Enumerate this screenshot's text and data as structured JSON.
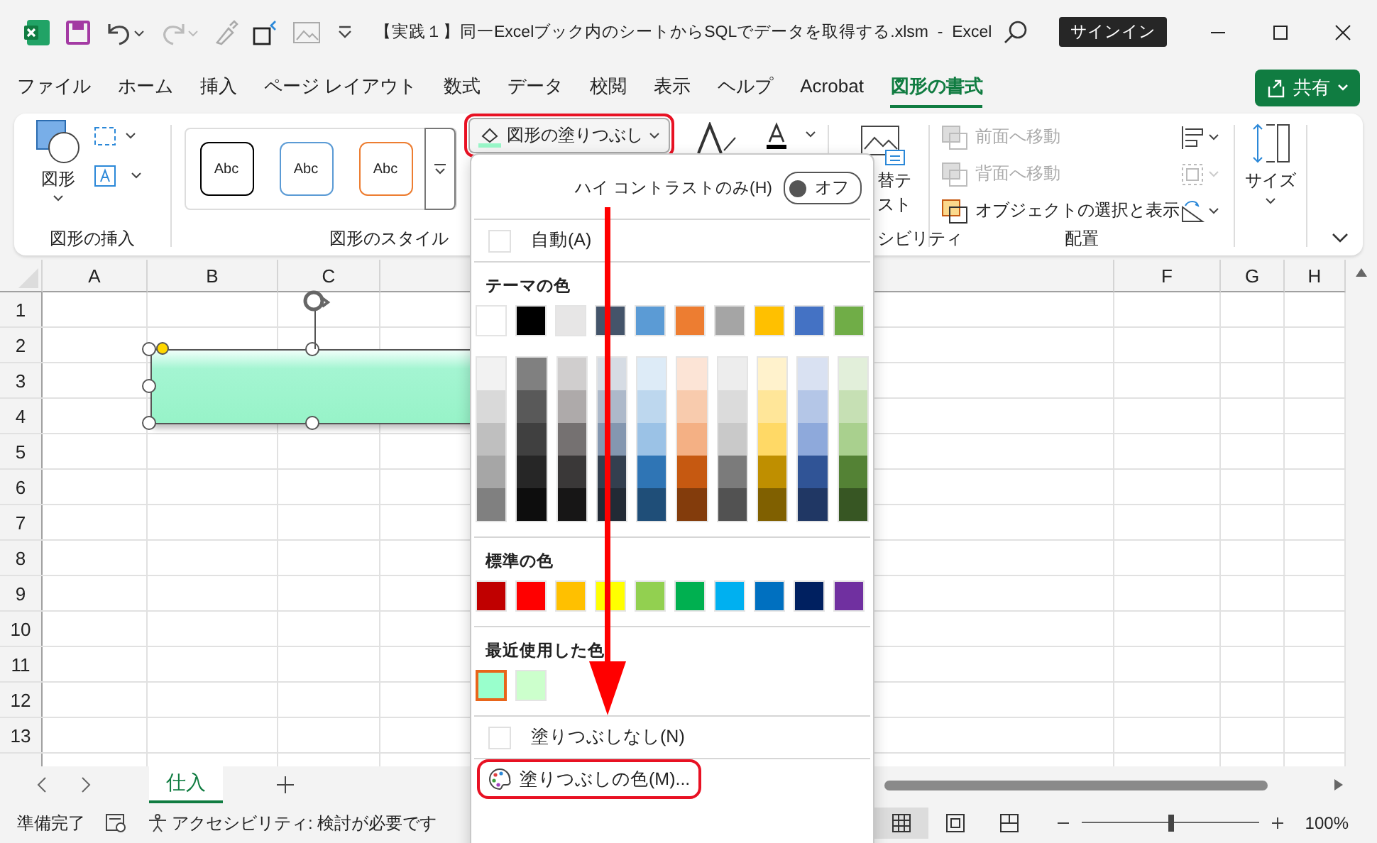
{
  "title_bar": {
    "title": "【実践１】同一Excelブック内のシートからSQLでデータを取得する.xlsm  -  Excel",
    "sign_in": "サインイン"
  },
  "menu_tabs": [
    {
      "label": "ファイル",
      "selected": false
    },
    {
      "label": "ホーム",
      "selected": false
    },
    {
      "label": "挿入",
      "selected": false
    },
    {
      "label": "ページ レイアウト",
      "selected": false
    },
    {
      "label": "数式",
      "selected": false
    },
    {
      "label": "データ",
      "selected": false
    },
    {
      "label": "校閲",
      "selected": false
    },
    {
      "label": "表示",
      "selected": false
    },
    {
      "label": "ヘルプ",
      "selected": false
    },
    {
      "label": "Acrobat",
      "selected": false
    },
    {
      "label": "図形の書式",
      "selected": true
    }
  ],
  "share_button": {
    "label": "共有"
  },
  "ribbon": {
    "insert_group": {
      "shapes": "図形",
      "label": "図形の挿入"
    },
    "style_group": {
      "samples": [
        {
          "label": "Abc",
          "color": "#000000"
        },
        {
          "label": "Abc",
          "color": "#5b9bd5"
        },
        {
          "label": "Abc",
          "color": "#ed7d31"
        }
      ],
      "label": "図形のスタイル"
    },
    "fill_button": {
      "label": "図形の塗りつぶし",
      "highlighted": true
    },
    "alt_text": {
      "lines": [
        "替テ",
        "スト"
      ],
      "label": "シビリティ"
    },
    "arrange": {
      "items": [
        {
          "label": "前面へ移動",
          "disabled": true
        },
        {
          "label": "背面へ移動",
          "disabled": true
        },
        {
          "label": "オブジェクトの選択と表示",
          "disabled": false
        }
      ],
      "label": "配置"
    },
    "size": {
      "label": "サイズ"
    }
  },
  "sheet": {
    "columns_left": [
      "A",
      "B",
      "C"
    ],
    "columns_right": [
      "F",
      "G",
      "H"
    ],
    "rows": [
      "1",
      "2",
      "3",
      "4",
      "5",
      "6",
      "7",
      "8",
      "9",
      "10",
      "11",
      "12",
      "13"
    ]
  },
  "sheet_tabs": [
    {
      "label": "仕入",
      "selected": true
    }
  ],
  "status_bar": {
    "ready": "準備完了",
    "accessibility": "アクセシビリティ: 検討が必要です",
    "views": [
      {
        "kind": "normal",
        "selected": true
      },
      {
        "kind": "page_layout",
        "selected": false
      },
      {
        "kind": "page_break",
        "selected": false
      }
    ],
    "zoom": {
      "level": 0.5,
      "label": "100%"
    }
  },
  "fill_menu": {
    "high_contrast": {
      "label": "ハイ コントラストのみ(H)",
      "state": "オフ",
      "on": false
    },
    "automatic": "自動(A)",
    "theme_heading": "テーマの色",
    "theme_colors": [
      {
        "color": "#ffffff",
        "selected": false
      },
      {
        "color": "#000000",
        "selected": false
      },
      {
        "color": "#e7e6e6",
        "selected": false
      },
      {
        "color": "#44546a",
        "selected": false
      },
      {
        "color": "#5b9bd5",
        "selected": false
      },
      {
        "color": "#ed7d31",
        "selected": false
      },
      {
        "color": "#a5a5a5",
        "selected": false
      },
      {
        "color": "#ffc000",
        "selected": false
      },
      {
        "color": "#4472c4",
        "selected": false
      },
      {
        "color": "#70ad47",
        "selected": false
      }
    ],
    "theme_shades": [
      {
        "shades": [
          {
            "color": "#f2f2f2",
            "selected": false
          },
          {
            "color": "#d9d9d9",
            "selected": false
          },
          {
            "color": "#bfbfbf",
            "selected": false
          },
          {
            "color": "#a6a6a6",
            "selected": false
          },
          {
            "color": "#808080",
            "selected": false
          }
        ]
      },
      {
        "shades": [
          {
            "color": "#808080",
            "selected": false
          },
          {
            "color": "#595959",
            "selected": false
          },
          {
            "color": "#404040",
            "selected": false
          },
          {
            "color": "#262626",
            "selected": false
          },
          {
            "color": "#0d0d0d",
            "selected": false
          }
        ]
      },
      {
        "shades": [
          {
            "color": "#d0cece",
            "selected": false
          },
          {
            "color": "#aeaaaa",
            "selected": false
          },
          {
            "color": "#757171",
            "selected": false
          },
          {
            "color": "#3a3838",
            "selected": false
          },
          {
            "color": "#171616",
            "selected": false
          }
        ]
      },
      {
        "shades": [
          {
            "color": "#d6dce4",
            "selected": false
          },
          {
            "color": "#adb9ca",
            "selected": false
          },
          {
            "color": "#8497b0",
            "selected": false
          },
          {
            "color": "#333f4f",
            "selected": false
          },
          {
            "color": "#222a35",
            "selected": false
          }
        ]
      },
      {
        "shades": [
          {
            "color": "#ddebf7",
            "selected": false
          },
          {
            "color": "#bdd7ee",
            "selected": false
          },
          {
            "color": "#9bc2e6",
            "selected": false
          },
          {
            "color": "#2f75b5",
            "selected": false
          },
          {
            "color": "#1f4e78",
            "selected": false
          }
        ]
      },
      {
        "shades": [
          {
            "color": "#fce4d6",
            "selected": false
          },
          {
            "color": "#f8cbad",
            "selected": false
          },
          {
            "color": "#f4b084",
            "selected": false
          },
          {
            "color": "#c65911",
            "selected": false
          },
          {
            "color": "#833c0c",
            "selected": false
          }
        ]
      },
      {
        "shades": [
          {
            "color": "#ededed",
            "selected": false
          },
          {
            "color": "#dbdbdb",
            "selected": false
          },
          {
            "color": "#c9c9c9",
            "selected": false
          },
          {
            "color": "#7b7b7b",
            "selected": false
          },
          {
            "color": "#525252",
            "selected": false
          }
        ]
      },
      {
        "shades": [
          {
            "color": "#fff2cc",
            "selected": false
          },
          {
            "color": "#ffe699",
            "selected": false
          },
          {
            "color": "#ffd966",
            "selected": false
          },
          {
            "color": "#bf8f00",
            "selected": false
          },
          {
            "color": "#806000",
            "selected": false
          }
        ]
      },
      {
        "shades": [
          {
            "color": "#d9e1f2",
            "selected": false
          },
          {
            "color": "#b4c6e7",
            "selected": false
          },
          {
            "color": "#8ea9db",
            "selected": false
          },
          {
            "color": "#305496",
            "selected": false
          },
          {
            "color": "#203764",
            "selected": false
          }
        ]
      },
      {
        "shades": [
          {
            "color": "#e2efda",
            "selected": false
          },
          {
            "color": "#c6e0b4",
            "selected": false
          },
          {
            "color": "#a9d08e",
            "selected": false
          },
          {
            "color": "#548235",
            "selected": false
          },
          {
            "color": "#375623",
            "selected": false
          }
        ]
      }
    ],
    "standard_heading": "標準の色",
    "standard_colors": [
      {
        "color": "#c00000",
        "selected": false
      },
      {
        "color": "#ff0000",
        "selected": false
      },
      {
        "color": "#ffc000",
        "selected": false
      },
      {
        "color": "#ffff00",
        "selected": false
      },
      {
        "color": "#92d050",
        "selected": false
      },
      {
        "color": "#00b050",
        "selected": false
      },
      {
        "color": "#00b0f0",
        "selected": false
      },
      {
        "color": "#0070c0",
        "selected": false
      },
      {
        "color": "#002060",
        "selected": false
      },
      {
        "color": "#7030a0",
        "selected": false
      }
    ],
    "recent_heading": "最近使用した色",
    "recent_colors": [
      {
        "color": "#99ffcc",
        "selected": true
      },
      {
        "color": "#ccffcc",
        "selected": false
      }
    ],
    "no_fill": "塗りつぶしなし(N)",
    "more_colors": {
      "label": "塗りつぶしの色(M)...",
      "highlighted": true
    }
  }
}
